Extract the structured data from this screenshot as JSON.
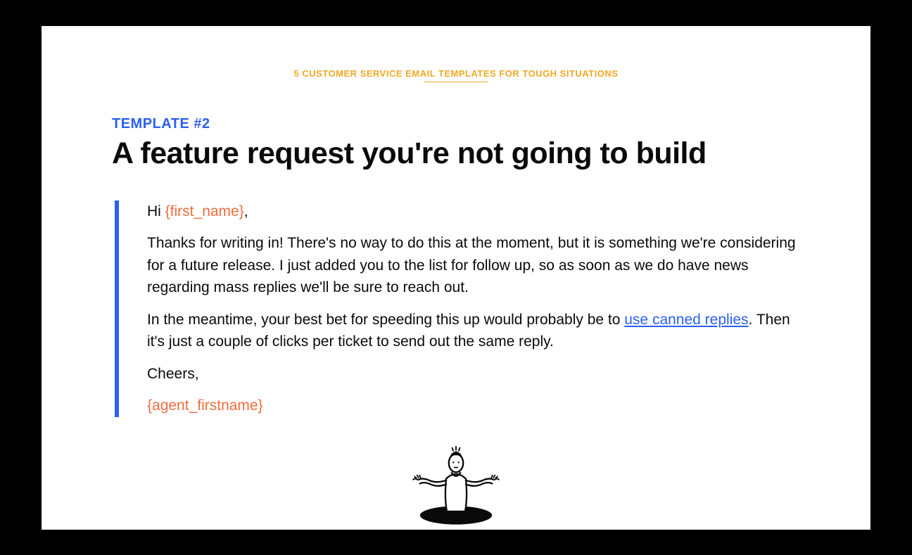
{
  "header": {
    "label": "5 CUSTOMER SERVICE EMAIL TEMPLATES FOR TOUGH SITUATIONS"
  },
  "template": {
    "label": "TEMPLATE #2",
    "title": "A feature request you're not going to build"
  },
  "email": {
    "greeting_prefix": "Hi ",
    "greeting_placeholder": "{first_name}",
    "greeting_suffix": ",",
    "p1": "Thanks for writing in! There's no way to do this at the moment, but it is something we're considering for a future release. I just added you to the list for follow up, so as soon as we do have news regarding mass replies we'll be sure to reach out.",
    "p2_prefix": "In the meantime, your best bet for speeding this up would probably be to ",
    "p2_link": "use canned replies",
    "p2_suffix": ". Then it's just a couple of clicks per ticket to send out the same reply.",
    "signoff": "Cheers,",
    "agent_placeholder": "{agent_firstname}"
  }
}
